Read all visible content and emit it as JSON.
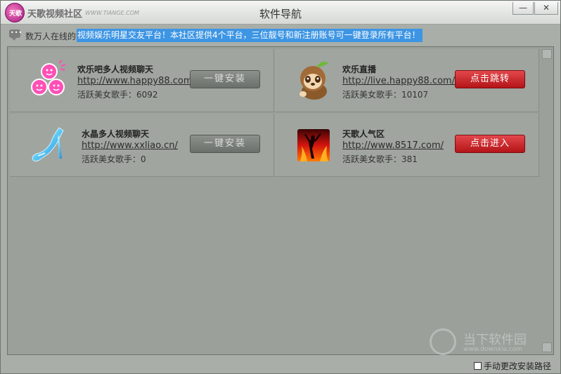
{
  "window": {
    "title": "软件导航",
    "brand": "天歌视频社区",
    "brand_url": "WWW.TIANGE.COM",
    "logo_text": "天歌",
    "minimize_glyph": "—",
    "close_glyph": "✕"
  },
  "notice": {
    "prefix": "数万人在线的",
    "highlight": "视频娱乐明星交友平台！本社区提供4个平台，三位靓号和新注册账号可一键登录所有平台！"
  },
  "cards": [
    {
      "name": "欢乐吧多人视频聊天",
      "url": "http://www.happy88.com",
      "stat": "活跃美女歌手：6092",
      "button": "一键安装",
      "button_type": "install",
      "icon": "pink-faces-icon"
    },
    {
      "name": "欢乐直播",
      "url": "http://live.happy88.com/",
      "stat": "活跃美女歌手：10107",
      "button": "点击跳转",
      "button_type": "go",
      "icon": "sloth-mascot-icon"
    },
    {
      "name": "水晶多人视频聊天",
      "url": "http://www.xxliao.cn/",
      "stat": "活跃美女歌手：0",
      "button": "一键安装",
      "button_type": "install",
      "icon": "crystal-shoe-icon"
    },
    {
      "name": "天歌人气区",
      "url": "http://www.8517.com/",
      "stat": "活跃美女歌手：381",
      "button": "点击进入",
      "button_type": "go",
      "icon": "fire-dancer-icon"
    }
  ],
  "watermark": {
    "text": "当下软件园",
    "sub": "www.downxia.com"
  },
  "footer": {
    "checkbox_label": "手动更改安装路径"
  },
  "colors": {
    "highlight": "#3d95e4",
    "install_button": "#7d827d",
    "go_button": "#c8282c",
    "panel": "#a0a59f"
  }
}
